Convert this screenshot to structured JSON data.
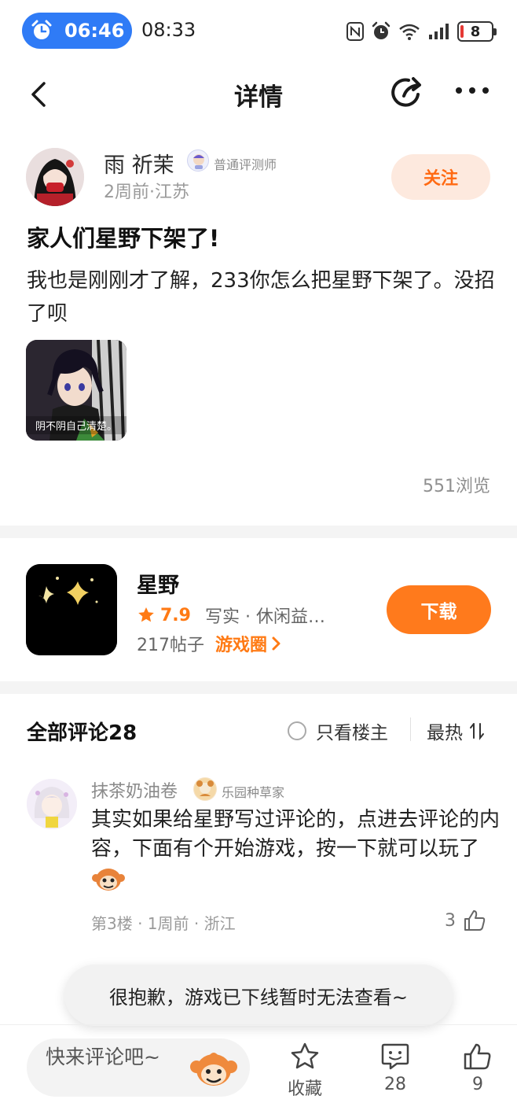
{
  "status_bar": {
    "alarm_time": "06:46",
    "clock": "08:33",
    "battery": "8"
  },
  "nav": {
    "title": "详情"
  },
  "post": {
    "author_name": "雨 祈茉",
    "author_title": "普通评测师",
    "meta": "2周前·江苏",
    "follow_label": "关注",
    "title": "家人们星野下架了!",
    "body": "我也是刚刚才了解，233你怎么把星野下架了。没招了呗",
    "image_caption": "阴不阴自己清楚。",
    "views": "551浏览"
  },
  "game": {
    "name": "星野",
    "rating": "7.9",
    "tags": "写实 · 休闲益…",
    "posts": "217帖子",
    "circle_label": "游戏圈",
    "download_label": "下载"
  },
  "comments": {
    "header": "全部评论28",
    "only_author": "只看楼主",
    "sort": "最热",
    "items": [
      {
        "name": "抹茶奶油卷",
        "badge": "乐园种草家",
        "body": "其实如果给星野写过评论的，点进去评论的内容，下面有个开始游戏，按一下就可以玩了",
        "meta": "第3楼 · 1周前 · 浙江",
        "likes": "3"
      }
    ]
  },
  "toast": "很抱歉，游戏已下线暂时无法查看~",
  "bottom_bar": {
    "input_placeholder": "快来评论吧~",
    "favorite_label": "收藏",
    "comment_count": "28",
    "like_count": "9"
  },
  "colors": {
    "accent": "#ff7a1c",
    "follow_bg": "#fde9de",
    "alarm_pill": "#2f7bf6"
  }
}
